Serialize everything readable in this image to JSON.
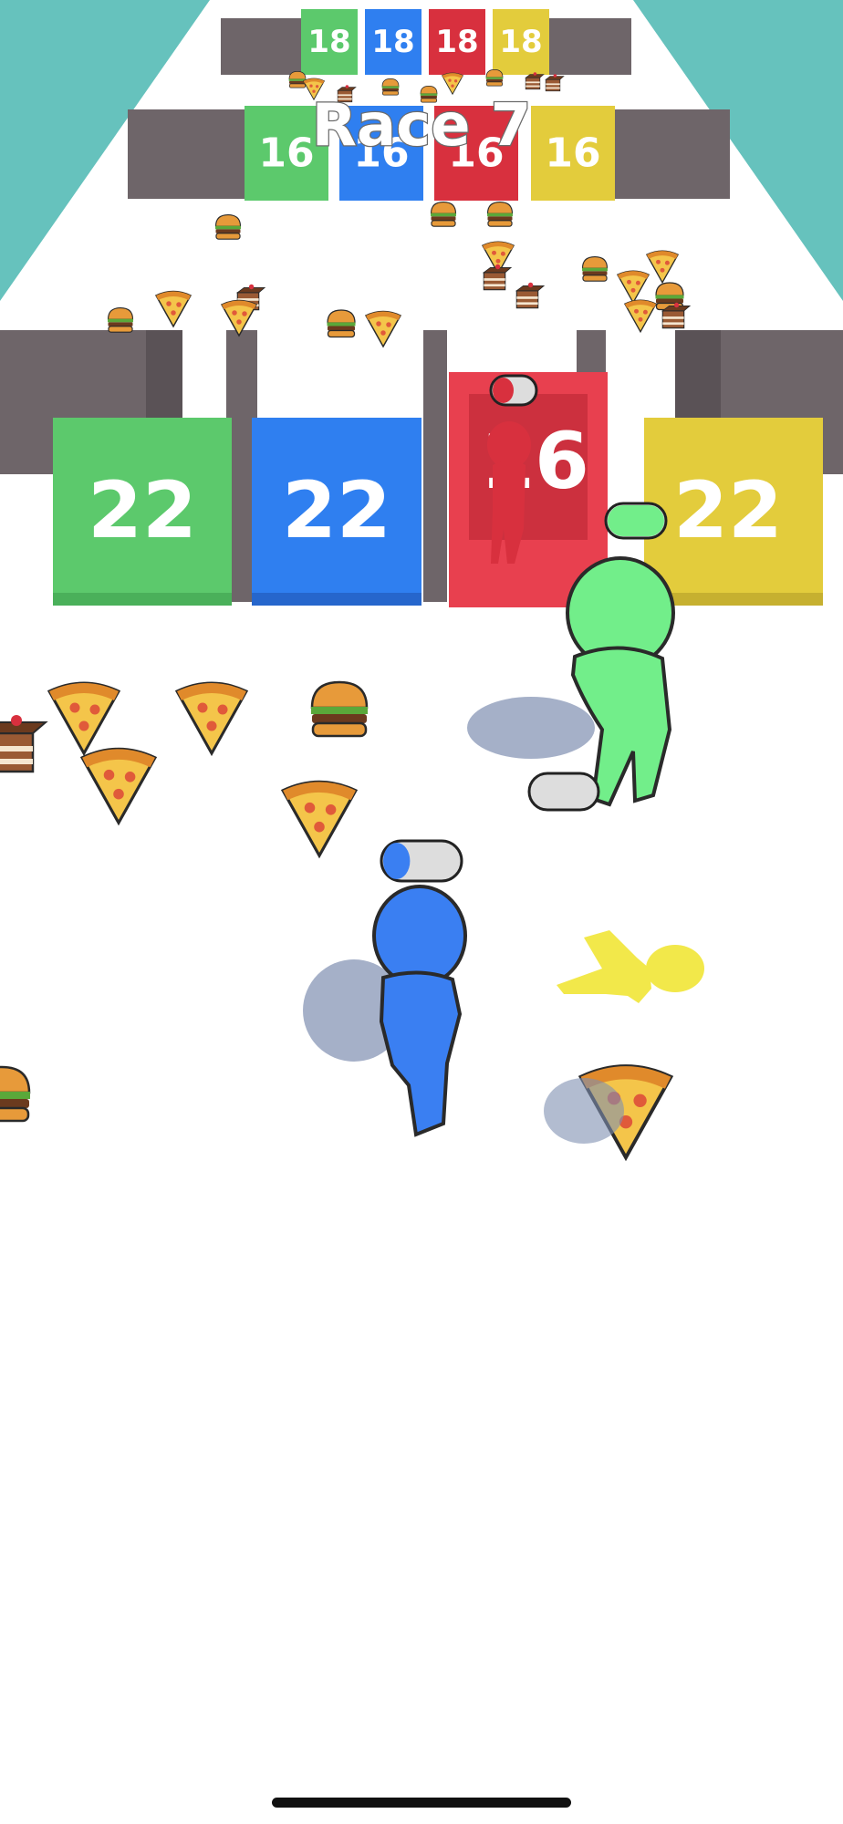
{
  "hud": {
    "title": "Race 7"
  },
  "gate_rows": [
    {
      "row": "far",
      "values": [
        "18",
        "18",
        "18",
        "18"
      ],
      "colors": [
        "#5cc96c",
        "#2f7ff0",
        "#d8303e",
        "#e3cc3c"
      ]
    },
    {
      "row": "mid",
      "values": [
        "16",
        "16",
        "16",
        "16"
      ],
      "colors": [
        "#5cc96c",
        "#2f7ff0",
        "#d8303e",
        "#e3cc3c"
      ]
    },
    {
      "row": "near",
      "values": [
        "22",
        "22",
        "16",
        "22"
      ],
      "colors": [
        "#5cc96c",
        "#2f7ff0",
        "#e8404f",
        "#e3cc3c"
      ]
    }
  ],
  "racers": [
    {
      "name": "player",
      "color": "#3a7ff2",
      "progress": 0.35
    },
    {
      "name": "green-rival",
      "color": "#72ee8a",
      "progress": 1.0
    },
    {
      "name": "red-rival",
      "color": "#d8303e",
      "progress": 0.5
    },
    {
      "name": "yellow-rival",
      "color": "#f2e84a",
      "progress": 0.0
    }
  ],
  "food_items": [
    "pizza",
    "burger",
    "cake"
  ],
  "colors": {
    "sky": "#66c2bd",
    "floor": "#ffffff",
    "wall": "#6e6569",
    "progress_empty": "#dddddd"
  }
}
